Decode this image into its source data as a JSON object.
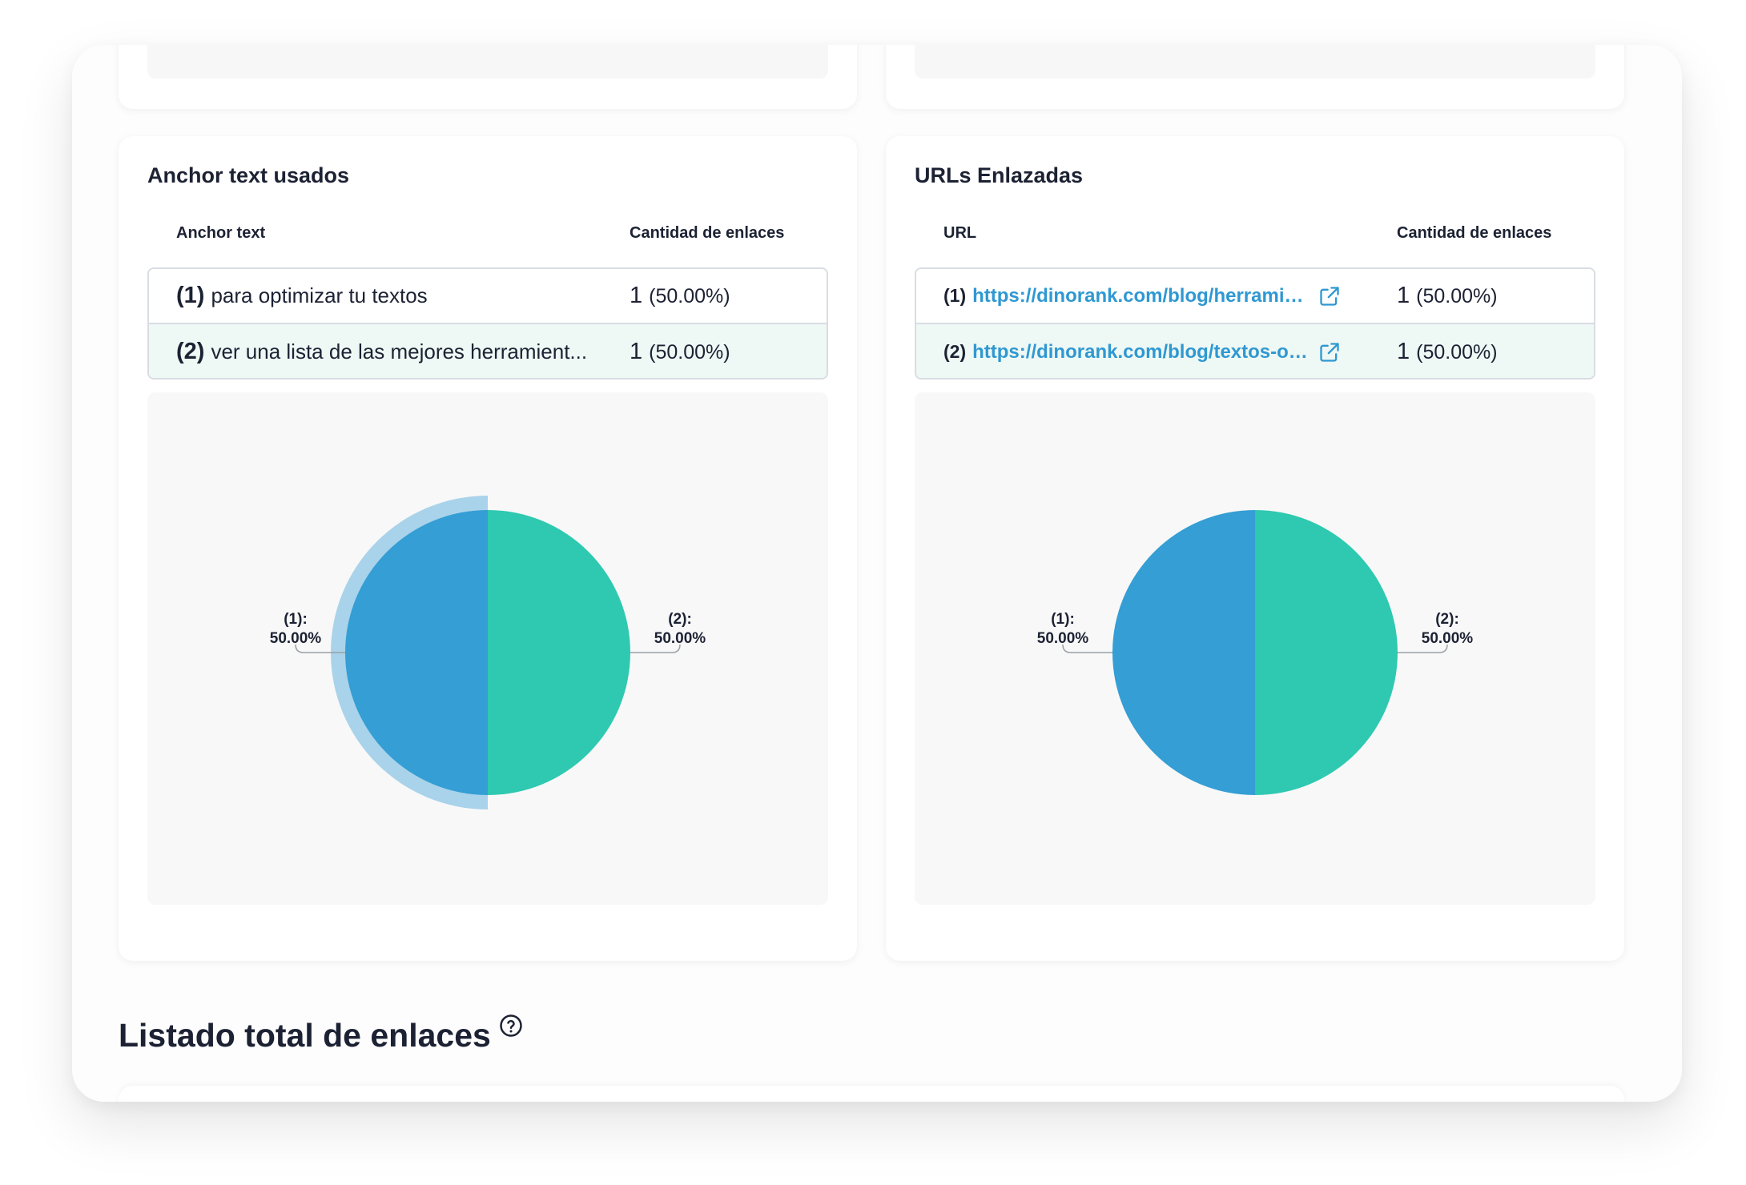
{
  "anchor_section": {
    "title": "Anchor text usados",
    "col_anchor": "Anchor text",
    "col_count": "Cantidad de enlaces",
    "rows": [
      {
        "idx": "(1)",
        "text": "para optimizar tu textos",
        "count": "1",
        "pct": "(50.00%)"
      },
      {
        "idx": "(2)",
        "text": "ver una lista de  las mejores herramient...",
        "count": "1",
        "pct": "(50.00%)"
      }
    ]
  },
  "url_section": {
    "title": "URLs Enlazadas",
    "col_url": "URL",
    "col_count": "Cantidad de enlaces",
    "rows": [
      {
        "idx": "(1)",
        "url": "https://dinorank.com/blog/herramie...",
        "count": "1",
        "pct": "(50.00%)"
      },
      {
        "idx": "(2)",
        "url": "https://dinorank.com/blog/textos-op...",
        "count": "1",
        "pct": "(50.00%)"
      }
    ]
  },
  "listado": {
    "title": "Listado total de enlaces"
  },
  "colors": {
    "blue": "#349ed5",
    "green": "#2ec9b0",
    "blue_hover": "#a9d3ea",
    "link": "#2f98d2"
  },
  "chart_data": [
    {
      "type": "pie",
      "categories": [
        "(1)",
        "(2)"
      ],
      "values": [
        50.0,
        50.0
      ],
      "labels": [
        {
          "key": "(1):",
          "value": "50.00%"
        },
        {
          "key": "(2):",
          "value": "50.00%"
        }
      ],
      "highlighted_index": 0
    },
    {
      "type": "pie",
      "categories": [
        "(1)",
        "(2)"
      ],
      "values": [
        50.0,
        50.0
      ],
      "labels": [
        {
          "key": "(1):",
          "value": "50.00%"
        },
        {
          "key": "(2):",
          "value": "50.00%"
        }
      ],
      "highlighted_index": null
    }
  ]
}
